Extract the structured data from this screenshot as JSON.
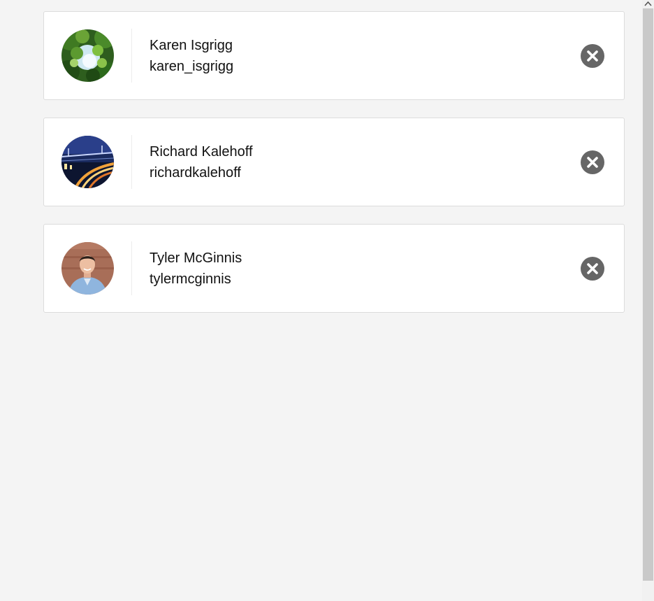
{
  "users": [
    {
      "name": "Karen Isgrigg",
      "handle": "karen_isgrigg",
      "avatar": "tree-canopy-photo"
    },
    {
      "name": "Richard Kalehoff",
      "handle": "richardkalehoff",
      "avatar": "bridge-night-photo"
    },
    {
      "name": "Tyler McGinnis",
      "handle": "tylermcginnis",
      "avatar": "man-portrait-photo"
    }
  ],
  "icons": {
    "remove": "close-circle-icon",
    "scroll_up": "chevron-up-icon"
  },
  "colors": {
    "background": "#f4f4f4",
    "card": "#ffffff",
    "remove_button": "#666666"
  }
}
